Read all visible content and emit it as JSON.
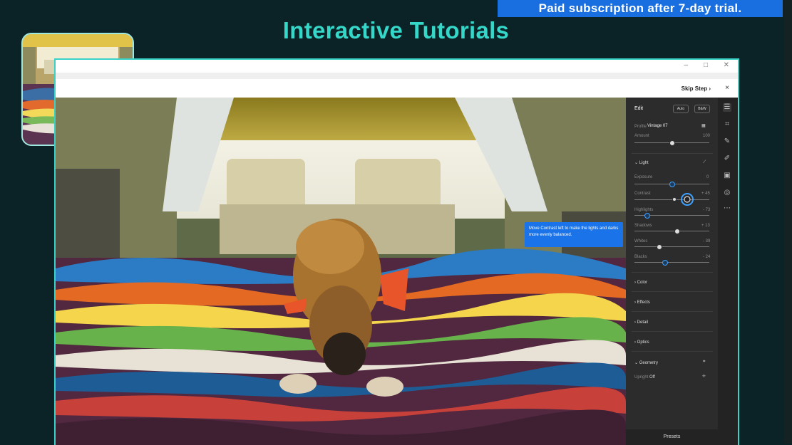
{
  "banner": {
    "text": "Paid subscription after 7-day trial."
  },
  "heading": {
    "title": "Interactive Tutorials"
  },
  "window": {
    "controls": {
      "minimize": "–",
      "maximize": "□",
      "close": "✕"
    },
    "skip_step_label": "Skip Step",
    "skip_step_chevron": "›",
    "close_label": "×"
  },
  "tooltip": {
    "text": "Move Contrast left to make the lights and darks more evenly balanced."
  },
  "panel": {
    "title": "Edit",
    "auto_label": "Auto",
    "bw_label": "B&W",
    "profile_label": "Profile",
    "profile_value": "Vintage 07",
    "amount_label": "Amount",
    "amount_value": "100",
    "sections": {
      "light": "Light",
      "color": "Color",
      "effects": "Effects",
      "detail": "Detail",
      "optics": "Optics",
      "geometry": "Geometry"
    },
    "sliders": [
      {
        "label": "Exposure",
        "value": "0"
      },
      {
        "label": "Contrast",
        "value": "+ 45"
      },
      {
        "label": "Highlights",
        "value": "- 73"
      },
      {
        "label": "Shadows",
        "value": "+ 13"
      },
      {
        "label": "Whites",
        "value": "- 39"
      },
      {
        "label": "Blacks",
        "value": "- 24"
      }
    ],
    "upright_label": "Upright",
    "upright_value": "Off",
    "presets_label": "Presets"
  },
  "toolstrip": {
    "icons": [
      "sliders-icon",
      "crop-icon",
      "healing-icon",
      "brush-icon",
      "linear-gradient-icon",
      "radial-gradient-icon",
      "more-icon"
    ]
  },
  "colors": {
    "background": "#0b2226",
    "heading": "#35d7c9",
    "banner": "#1a6fe0",
    "tooltip": "#1a73e8",
    "window_border": "#39d2c8"
  }
}
